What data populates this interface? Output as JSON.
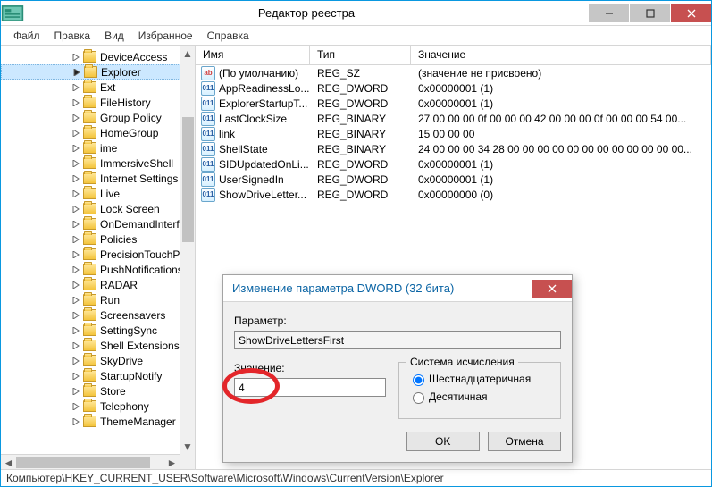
{
  "window": {
    "title": "Редактор реестра"
  },
  "menu": {
    "file": "Файл",
    "edit": "Правка",
    "view": "Вид",
    "favorites": "Избранное",
    "help": "Справка"
  },
  "tree": {
    "items": [
      "DeviceAccess",
      "Explorer",
      "Ext",
      "FileHistory",
      "Group Policy",
      "HomeGroup",
      "ime",
      "ImmersiveShell",
      "Internet Settings",
      "Live",
      "Lock Screen",
      "OnDemandInterfac",
      "Policies",
      "PrecisionTouchPa",
      "PushNotifications",
      "RADAR",
      "Run",
      "Screensavers",
      "SettingSync",
      "Shell Extensions",
      "SkyDrive",
      "StartupNotify",
      "Store",
      "Telephony",
      "ThemeManager"
    ],
    "selected_index": 1
  },
  "list": {
    "headers": {
      "name": "Имя",
      "type": "Тип",
      "value": "Значение"
    },
    "rows": [
      {
        "icon": "str",
        "name": "(По умолчанию)",
        "type": "REG_SZ",
        "value": "(значение не присвоено)"
      },
      {
        "icon": "bin",
        "name": "AppReadinessLo...",
        "type": "REG_DWORD",
        "value": "0x00000001 (1)"
      },
      {
        "icon": "bin",
        "name": "ExplorerStartupT...",
        "type": "REG_DWORD",
        "value": "0x00000001 (1)"
      },
      {
        "icon": "bin",
        "name": "LastClockSize",
        "type": "REG_BINARY",
        "value": "27 00 00 00 0f 00 00 00 42 00 00 00 0f 00 00 00 54 00..."
      },
      {
        "icon": "bin",
        "name": "link",
        "type": "REG_BINARY",
        "value": "15 00 00 00"
      },
      {
        "icon": "bin",
        "name": "ShellState",
        "type": "REG_BINARY",
        "value": "24 00 00 00 34 28 00 00 00 00 00 00 00 00 00 00 00 00..."
      },
      {
        "icon": "bin",
        "name": "SIDUpdatedOnLi...",
        "type": "REG_DWORD",
        "value": "0x00000001 (1)"
      },
      {
        "icon": "bin",
        "name": "UserSignedIn",
        "type": "REG_DWORD",
        "value": "0x00000001 (1)"
      },
      {
        "icon": "bin",
        "name": "ShowDriveLetter...",
        "type": "REG_DWORD",
        "value": "0x00000000 (0)"
      }
    ]
  },
  "dialog": {
    "title": "Изменение параметра DWORD (32 бита)",
    "param_label": "Параметр:",
    "param_value": "ShowDriveLettersFirst",
    "value_label": "Значение:",
    "value_input": "4",
    "radix_legend": "Система исчисления",
    "radix_hex": "Шестнадцатеричная",
    "radix_dec": "Десятичная",
    "ok": "OK",
    "cancel": "Отмена"
  },
  "statusbar": {
    "path": "Компьютер\\HKEY_CURRENT_USER\\Software\\Microsoft\\Windows\\CurrentVersion\\Explorer"
  }
}
